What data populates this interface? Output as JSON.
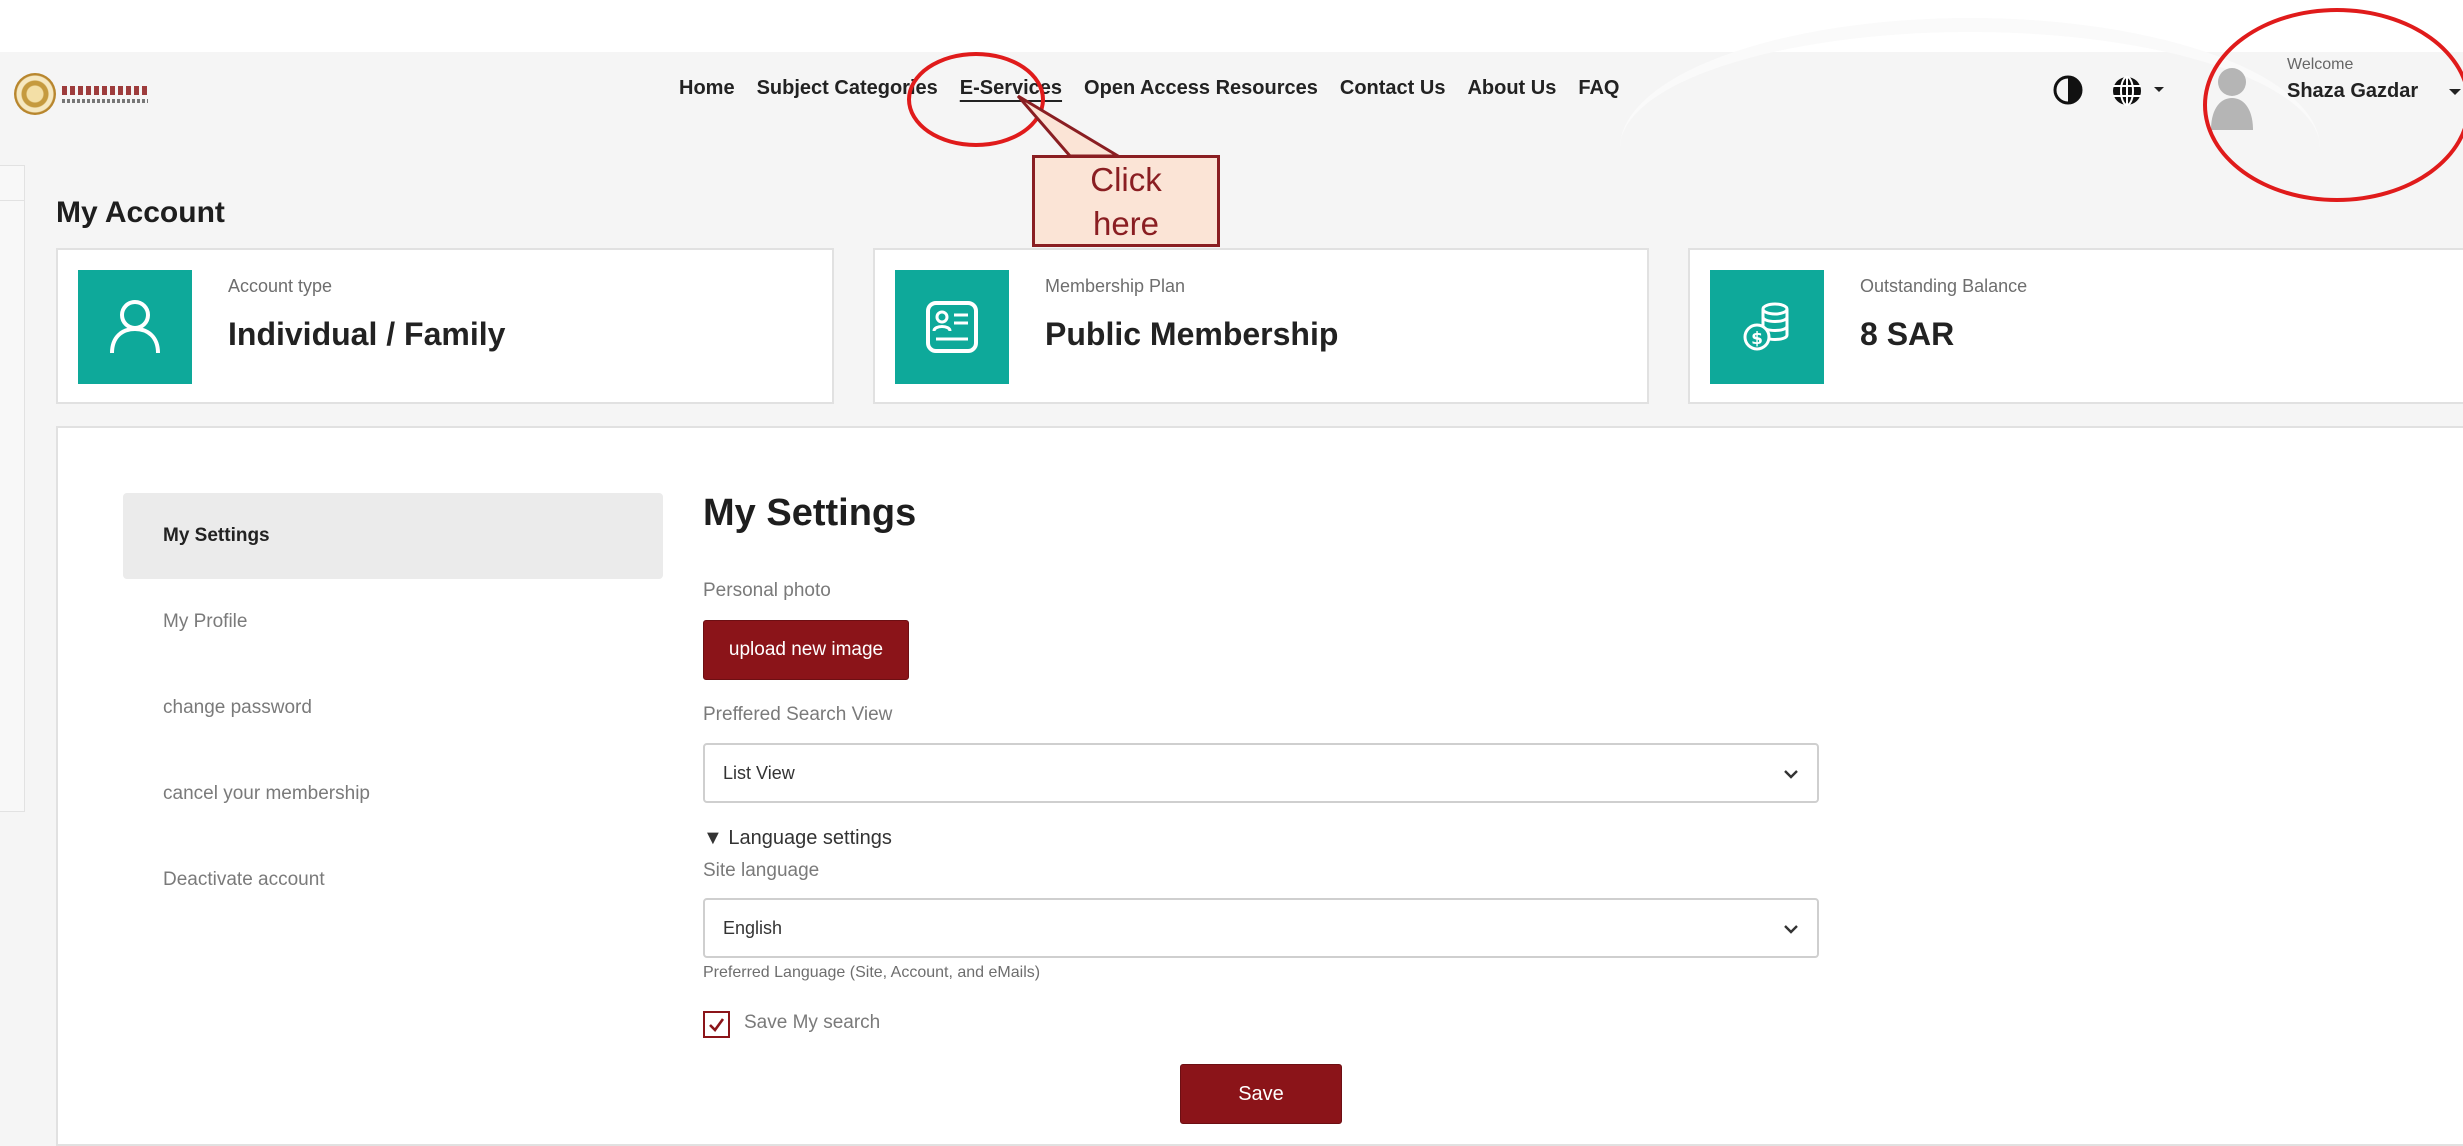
{
  "header": {
    "nav": [
      {
        "label": "Home"
      },
      {
        "label": "Subject Categories"
      },
      {
        "label": "E-Services"
      },
      {
        "label": "Open Access Resources"
      },
      {
        "label": "Contact Us"
      },
      {
        "label": "About Us"
      },
      {
        "label": "FAQ"
      }
    ],
    "welcome": "Welcome",
    "username": "Shaza Gazdar"
  },
  "annotation": {
    "callout_line1": "Click",
    "callout_line2": "here"
  },
  "page_title": "My Account",
  "cards": [
    {
      "label": "Account type",
      "value": "Individual / Family",
      "icon": "user-icon"
    },
    {
      "label": "Membership Plan",
      "value": "Public Membership",
      "icon": "membership-card-icon"
    },
    {
      "label": "Outstanding Balance",
      "value": "8 SAR",
      "icon": "coins-icon"
    }
  ],
  "side_menu": [
    {
      "label": "My Settings"
    },
    {
      "label": "My Profile"
    },
    {
      "label": "change password"
    },
    {
      "label": "cancel your membership"
    },
    {
      "label": "Deactivate account"
    }
  ],
  "settings": {
    "title": "My Settings",
    "photo_label": "Personal photo",
    "upload_label": "upload new image",
    "search_view_label": "Preffered Search View",
    "search_view_value": "List View",
    "lang_section": "Language settings",
    "site_lang_label": "Site language",
    "site_lang_value": "English",
    "site_lang_hint": "Preferred Language (Site, Account, and eMails)",
    "save_search_label": "Save My search",
    "save_search_checked": true,
    "save_label": "Save"
  },
  "colors": {
    "accent": "#8b1419",
    "teal": "#0ea99a",
    "annotation": "#e01b1b"
  }
}
